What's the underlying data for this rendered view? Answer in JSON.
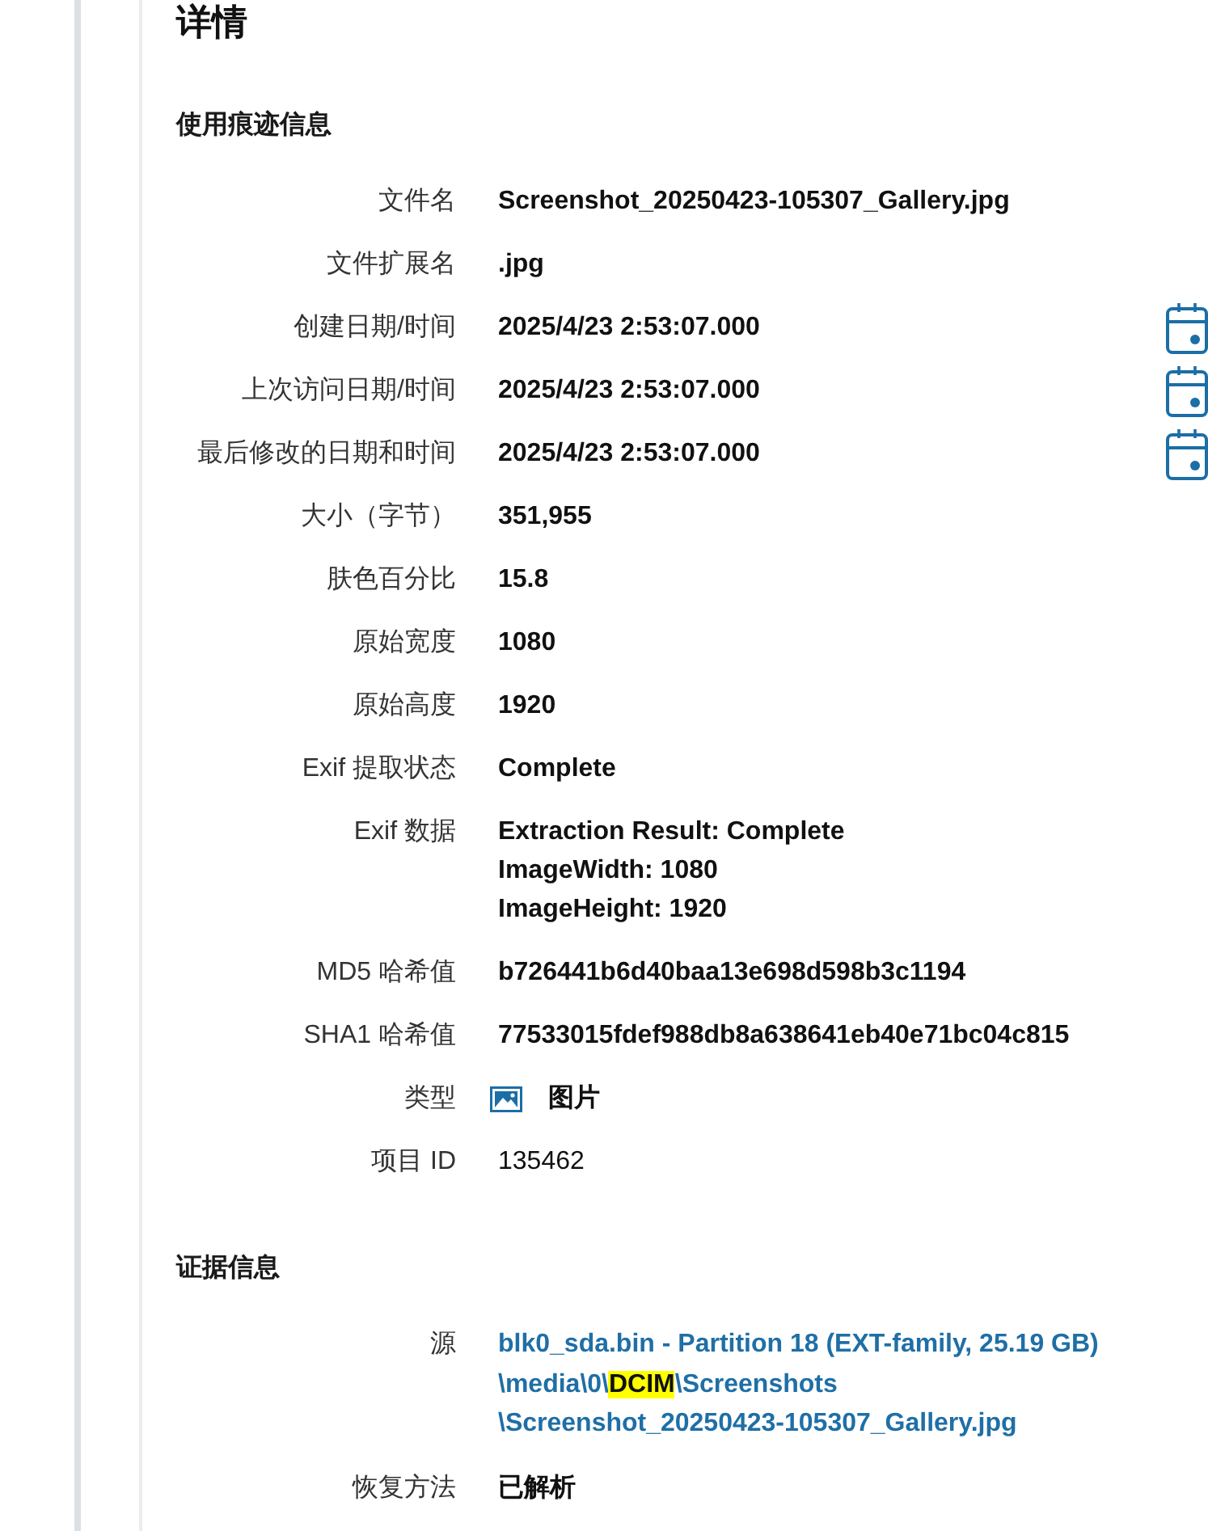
{
  "heading": "详情",
  "sections": [
    {
      "title": "使用痕迹信息",
      "rows": [
        {
          "kind": "text",
          "label": "文件名",
          "value": "Screenshot_20250423-105307_Gallery.jpg"
        },
        {
          "kind": "text",
          "label": "文件扩展名",
          "value": ".jpg"
        },
        {
          "kind": "date",
          "label": "创建日期/时间",
          "value": "2025/4/23 2:53:07.000"
        },
        {
          "kind": "date",
          "label": "上次访问日期/时间",
          "value": "2025/4/23 2:53:07.000"
        },
        {
          "kind": "date",
          "label": "最后修改的日期和时间",
          "value": "2025/4/23 2:53:07.000"
        },
        {
          "kind": "text",
          "label": "大小（字节）",
          "value": "351,955"
        },
        {
          "kind": "text",
          "label": "肤色百分比",
          "value": "15.8"
        },
        {
          "kind": "text",
          "label": "原始宽度",
          "value": "1080"
        },
        {
          "kind": "text",
          "label": "原始高度",
          "value": "1920"
        },
        {
          "kind": "text",
          "label": "Exif 提取状态",
          "value": "Complete"
        },
        {
          "kind": "lines",
          "label": "Exif 数据",
          "lines": [
            "Extraction Result: Complete",
            "ImageWidth: 1080",
            "ImageHeight: 1920"
          ]
        },
        {
          "kind": "text",
          "label": "MD5 哈希值",
          "value": "b726441b6d40baa13e698d598b3c1194"
        },
        {
          "kind": "text",
          "label": "SHA1 哈希值",
          "value": "77533015fdef988db8a638641eb40e71bc04c815"
        },
        {
          "kind": "type",
          "label": "类型",
          "value": "图片"
        },
        {
          "kind": "plain",
          "label": "项目 ID",
          "value": "135462"
        }
      ]
    },
    {
      "title": "证据信息",
      "rows": [
        {
          "kind": "link",
          "label": "源",
          "lines": [
            [
              {
                "text": "blk0_sda.bin - Partition 18 (EXT-family, 25.19 GB)",
                "highlighted": false
              }
            ],
            [
              {
                "text": "\\media\\0\\",
                "highlighted": false
              },
              {
                "text": "DCIM",
                "highlighted": true
              },
              {
                "text": "\\Screenshots",
                "highlighted": false
              }
            ],
            [
              {
                "text": "\\Screenshot_20250423-105307_Gallery.jpg",
                "highlighted": false
              }
            ]
          ]
        },
        {
          "kind": "text",
          "label": "恢复方法",
          "value": "已解析"
        }
      ]
    }
  ]
}
